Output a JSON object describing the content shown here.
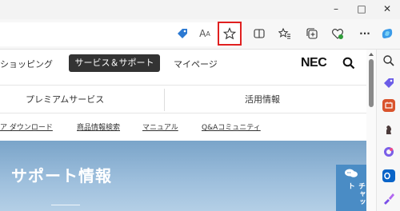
{
  "window": {
    "minimize": "–",
    "maximize": "□",
    "close": "✕"
  },
  "toolbar": {
    "read_aloud": "A",
    "more": "···"
  },
  "nav": {
    "shopping": "ショッピング",
    "support": "サービス＆サポート",
    "mypage": "マイページ",
    "logo": "NEC"
  },
  "subtabs": {
    "premium": "プレミアムサービス",
    "usage": "活用情報"
  },
  "links": {
    "download": "ア ダウンロード",
    "product_search": "商品情報検索",
    "manual": "マニュアル",
    "qa": "Q&Aコミュニティ"
  },
  "hero": {
    "title": "サポート情報"
  },
  "chat": {
    "label": "チャット"
  },
  "colors": {
    "accent": "#2b79d2",
    "highlight": "#e02020"
  }
}
